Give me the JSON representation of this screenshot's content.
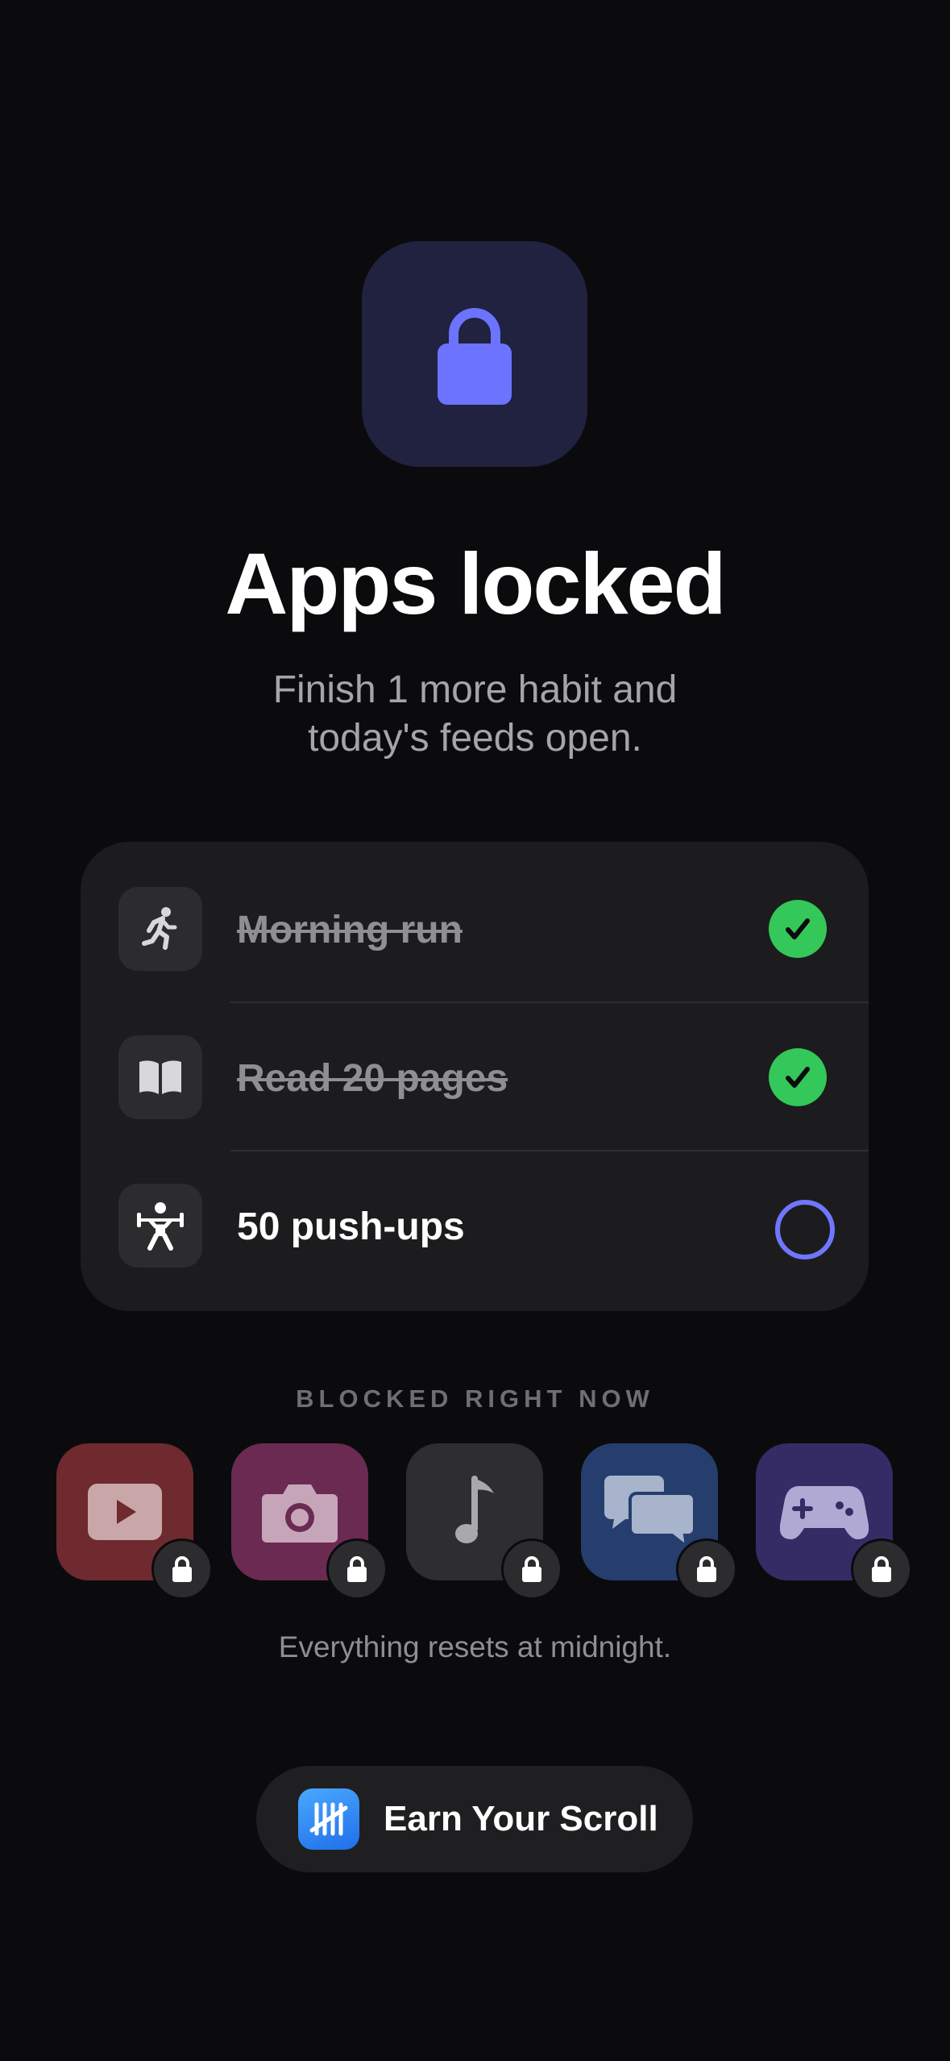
{
  "hero": {
    "icon": "lock-icon",
    "title": "Apps locked",
    "subtitle_line1": "Finish 1 more habit and",
    "subtitle_line2": "today's feeds open."
  },
  "habits": [
    {
      "label": "Morning run",
      "icon": "running-icon",
      "completed": true
    },
    {
      "label": "Read 20 pages",
      "icon": "book-icon",
      "completed": true
    },
    {
      "label": "50 push-ups",
      "icon": "weightlifting-icon",
      "completed": false
    }
  ],
  "blocked": {
    "section_label": "BLOCKED RIGHT NOW",
    "apps": [
      {
        "icon": "video-play-icon",
        "color": "#6e2a2e"
      },
      {
        "icon": "camera-icon",
        "color": "#6a2a52"
      },
      {
        "icon": "music-note-icon",
        "color": "#2e2e32"
      },
      {
        "icon": "chat-bubbles-icon",
        "color": "#253e6e"
      },
      {
        "icon": "game-controller-icon",
        "color": "#352c66"
      }
    ],
    "footnote": "Everything resets at midnight."
  },
  "cta": {
    "label": "Earn Your Scroll",
    "logo_icon": "tally-marks-icon"
  },
  "colors": {
    "background": "#0b0b0d",
    "accent": "#7077ff",
    "success": "#34c759",
    "card": "#1c1c1e"
  }
}
